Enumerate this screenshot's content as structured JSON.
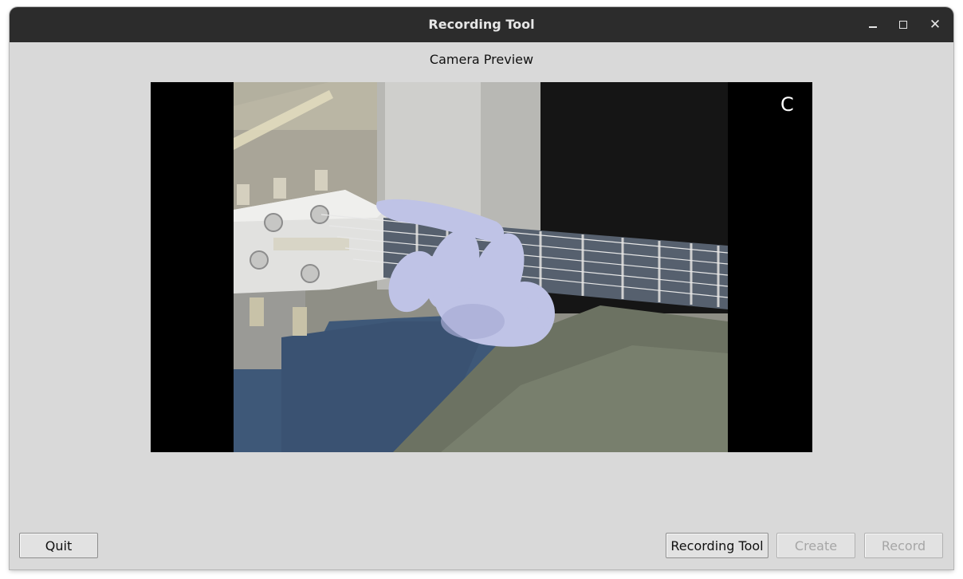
{
  "window": {
    "title": "Recording Tool",
    "controls": {
      "minimize_icon": "minimize-icon",
      "maximize_icon": "maximize-icon",
      "close_icon": "close-icon",
      "close_glyph": "✕"
    }
  },
  "preview": {
    "label": "Camera Preview",
    "chord": "C"
  },
  "buttons": {
    "quit": "Quit",
    "recording_tool": "Recording Tool",
    "create": "Create",
    "record": "Record"
  },
  "button_states": {
    "quit": "enabled",
    "recording_tool": "enabled",
    "create": "disabled",
    "record": "disabled"
  },
  "colors": {
    "titlebar": "#2c2c2c",
    "window_bg": "#d9d9d9",
    "disabled_text": "#a6a6a6"
  }
}
